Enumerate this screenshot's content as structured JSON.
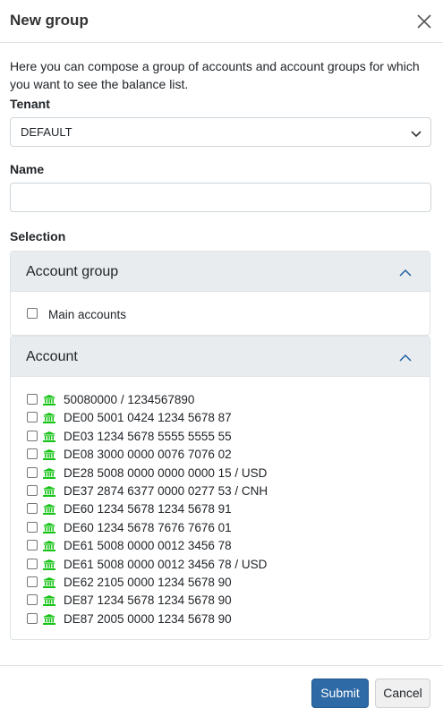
{
  "dialog": {
    "title": "New group",
    "description": "Here you can compose a group of accounts and account groups for which you want to see the balance list."
  },
  "tenant": {
    "label": "Tenant",
    "value": "DEFAULT"
  },
  "name": {
    "label": "Name",
    "value": "",
    "placeholder": ""
  },
  "selection": {
    "label": "Selection",
    "account_group": {
      "title": "Account group",
      "items": [
        {
          "label": "Main accounts",
          "checked": false
        }
      ]
    },
    "account": {
      "title": "Account",
      "items": [
        {
          "label": "50080000 / 1234567890",
          "checked": false
        },
        {
          "label": "DE00 5001 0424 1234 5678 87",
          "checked": false
        },
        {
          "label": "DE03 1234 5678 5555 5555 55",
          "checked": false
        },
        {
          "label": "DE08 3000 0000 0076 7076 02",
          "checked": false
        },
        {
          "label": "DE28 5008 0000 0000 0000 15 / USD",
          "checked": false
        },
        {
          "label": "DE37 2874 6377 0000 0277 53 / CNH",
          "checked": false
        },
        {
          "label": "DE60 1234 5678 1234 5678 91",
          "checked": false
        },
        {
          "label": "DE60 1234 5678 7676 7676 01",
          "checked": false
        },
        {
          "label": "DE61 5008 0000 0012 3456 78",
          "checked": false
        },
        {
          "label": "DE61 5008 0000 0012 3456 78 / USD",
          "checked": false
        },
        {
          "label": "DE62 2105 0000 1234 5678 90",
          "checked": false
        },
        {
          "label": "DE87 1234 5678 1234 5678 90",
          "checked": false
        },
        {
          "label": "DE87 2005 0000 1234 5678 90",
          "checked": false
        }
      ],
      "icon": "bank-icon"
    }
  },
  "footer": {
    "submit_label": "Submit",
    "cancel_label": "Cancel"
  },
  "colors": {
    "primary": "#2d6aa6",
    "bank_icon": "#16c316",
    "panel_header": "#e9ecef",
    "chevron": "#1f5fa0"
  }
}
